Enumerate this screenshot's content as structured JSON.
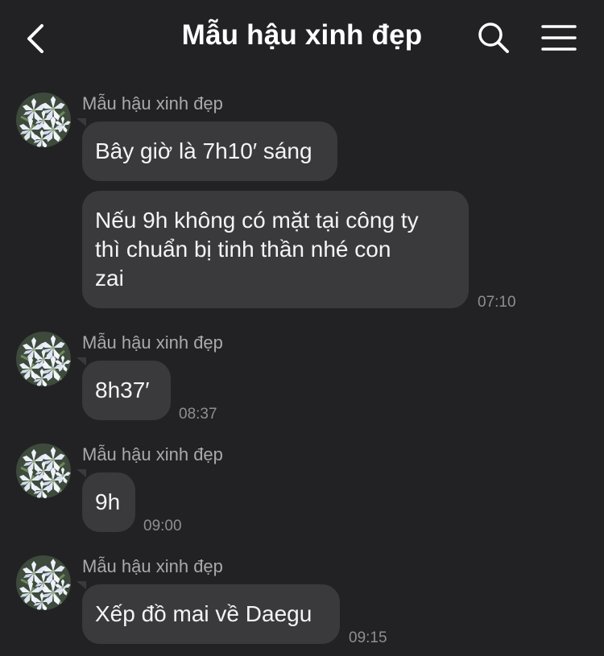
{
  "header": {
    "title": "Mẫu hậu xinh đẹp",
    "back_icon": "chevron-left-icon",
    "search_icon": "search-icon",
    "menu_icon": "hamburger-menu-icon"
  },
  "colors": {
    "background": "#222224",
    "bubble": "#3a3a3d",
    "sender_text": "#a9a9ad",
    "time_text": "#8e8e93"
  },
  "messages": [
    {
      "sender": "Mẫu hậu xinh đẹp",
      "bubbles": [
        {
          "text": "Bây giờ là 7h10′ sáng"
        },
        {
          "text": "Nếu 9h không có mặt tại công ty\nthì chuẩn bị tinh thần nhé con\nzai"
        }
      ],
      "time": "07:10"
    },
    {
      "sender": "Mẫu hậu xinh đẹp",
      "bubbles": [
        {
          "text": "8h37′"
        }
      ],
      "time": "08:37"
    },
    {
      "sender": "Mẫu hậu xinh đẹp",
      "bubbles": [
        {
          "text": "9h"
        }
      ],
      "time": "09:00"
    },
    {
      "sender": "Mẫu hậu xinh đẹp",
      "bubbles": [
        {
          "text": "Xếp đồ mai về Daegu"
        }
      ],
      "time": "09:15"
    }
  ]
}
